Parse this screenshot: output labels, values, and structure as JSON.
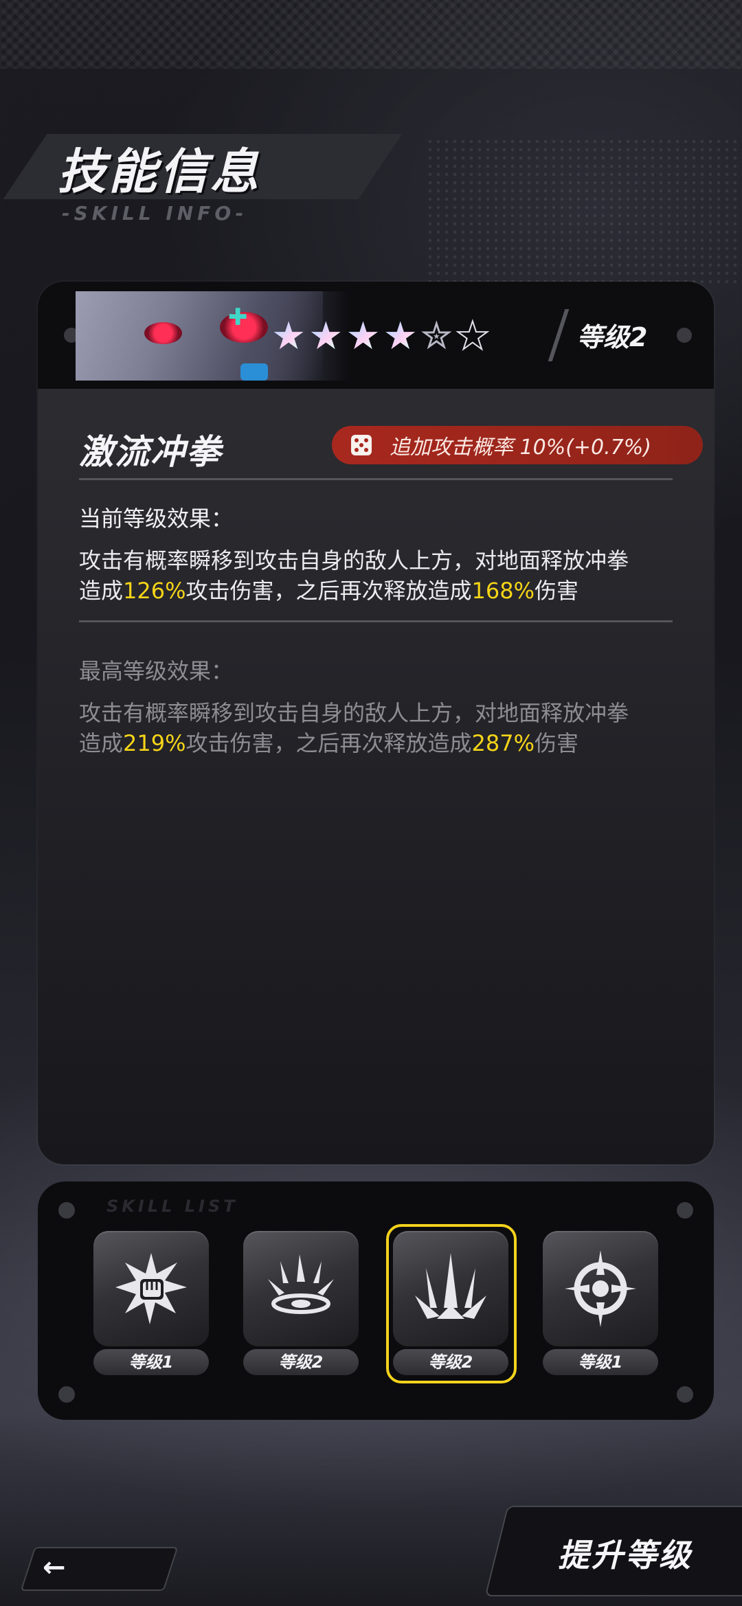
{
  "header": {
    "title": "技能信息",
    "subtitle": "-SKILL INFO-"
  },
  "skill_card": {
    "level_label": "等级2",
    "stars": {
      "filled": 4,
      "half": 1,
      "empty": 1
    },
    "skill_name": "激流冲拳",
    "bonus": {
      "icon": "dice-icon",
      "text": "追加攻击概率  10%(+0.7%)",
      "color": "#a8281e"
    },
    "current_effect": {
      "title": "当前等级效果：",
      "line1": "攻击有概率瞬移到攻击自身的敌人上方，对地面释放冲拳",
      "pre1": "造成",
      "val1": "126%",
      "mid": "攻击伤害，之后再次释放造成",
      "val2": "168%",
      "post": "伤害"
    },
    "max_effect": {
      "title": "最高等级效果：",
      "line1": "攻击有概率瞬移到攻击自身的敌人上方，对地面释放冲拳",
      "pre1": "造成",
      "val1": "219%",
      "mid": "攻击伤害，之后再次释放造成",
      "val2": "287%",
      "post": "伤害"
    },
    "highlight_color": "#f5d418"
  },
  "skill_list": {
    "subtitle": "SKILL LIST",
    "slots": [
      {
        "icon": "fist-burst-icon",
        "level": "等级1",
        "selected": false
      },
      {
        "icon": "ground-shock-icon",
        "level": "等级2",
        "selected": false
      },
      {
        "icon": "spike-burst-icon",
        "level": "等级2",
        "selected": true
      },
      {
        "icon": "crosshair-ring-icon",
        "level": "等级1",
        "selected": false
      }
    ],
    "selected_color": "#f3d21c"
  },
  "footer": {
    "back_icon": "back-arrow-icon",
    "back_symbol": "←",
    "upgrade_label": "提升等级"
  }
}
